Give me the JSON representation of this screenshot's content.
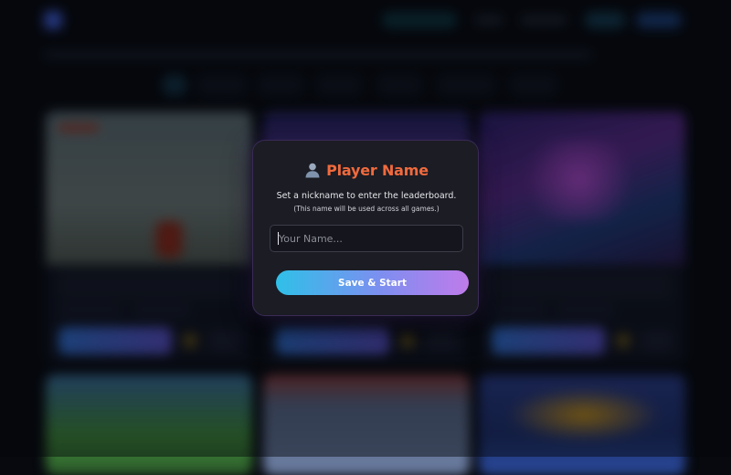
{
  "modal": {
    "icon": "user-icon",
    "title": "Player Name",
    "subtitle": "Set a nickname to enter the leaderboard.",
    "note": "(This name will be used across all games.)",
    "input": {
      "placeholder": "Your Name...",
      "value": ""
    },
    "button_label": "Save & Start"
  },
  "colors": {
    "title": "#f06a3d",
    "modal_bg": "#1b1c24",
    "button_gradient": [
      "#2fc0e8",
      "#7e8ef0",
      "#bf7bea"
    ],
    "page_bg": "#07090f"
  }
}
